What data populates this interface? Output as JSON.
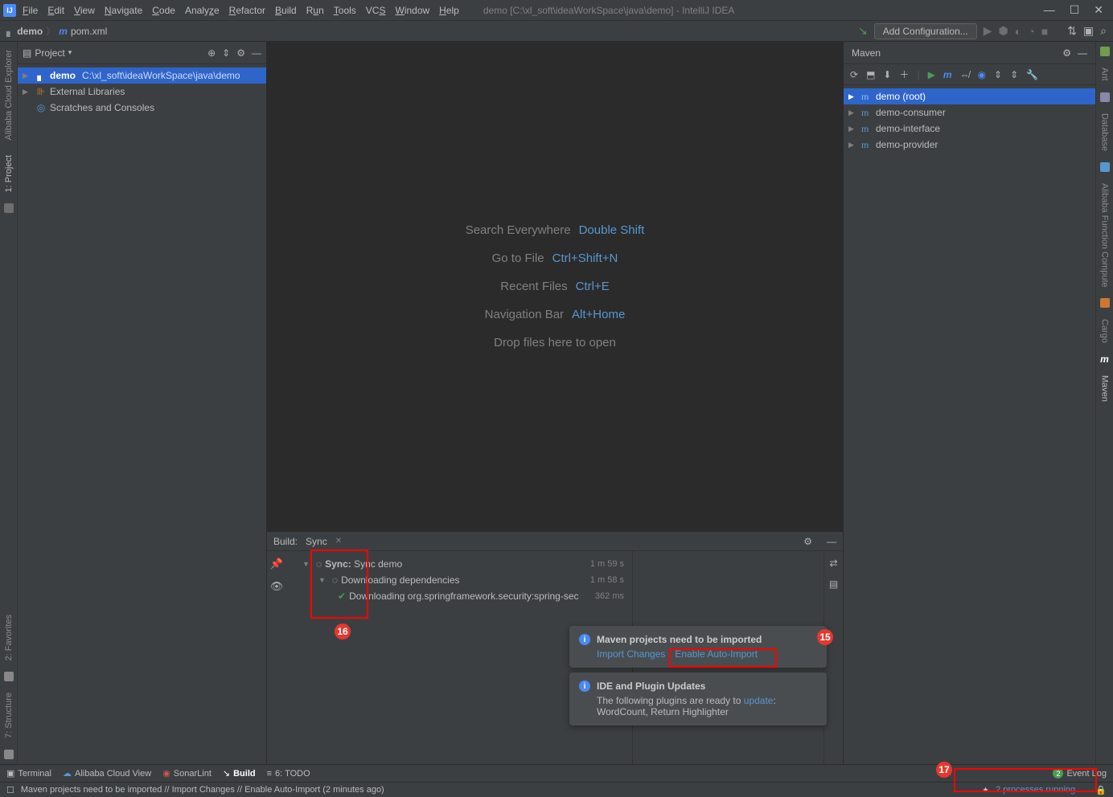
{
  "titlebar": {
    "menus": [
      "File",
      "Edit",
      "View",
      "Navigate",
      "Code",
      "Analyze",
      "Refactor",
      "Build",
      "Run",
      "Tools",
      "VCS",
      "Window",
      "Help"
    ],
    "title": "demo [C:\\xl_soft\\ideaWorkSpace\\java\\demo] - IntelliJ IDEA"
  },
  "breadcrumb": {
    "project": "demo",
    "file": "pom.xml"
  },
  "toolbar": {
    "config_label": "Add Configuration..."
  },
  "project": {
    "panel_title": "Project",
    "root_name": "demo",
    "root_path": "C:\\xl_soft\\ideaWorkSpace\\java\\demo",
    "ext_libs": "External Libraries",
    "scratches": "Scratches and Consoles"
  },
  "welcome": {
    "rows": [
      {
        "label": "Search Everywhere",
        "key": "Double Shift"
      },
      {
        "label": "Go to File",
        "key": "Ctrl+Shift+N"
      },
      {
        "label": "Recent Files",
        "key": "Ctrl+E"
      },
      {
        "label": "Navigation Bar",
        "key": "Alt+Home"
      },
      {
        "label": "Drop files here to open",
        "key": ""
      }
    ]
  },
  "build": {
    "title": "Build:",
    "tab": "Sync",
    "r1_label": "Sync:",
    "r1_val": "Sync demo",
    "r1_time": "1 m 59 s",
    "r2_val": "Downloading dependencies",
    "r2_time": "1 m 58 s",
    "r3_val": "Downloading org.springframework.security:spring-sec",
    "r3_time": "362 ms"
  },
  "maven": {
    "title": "Maven",
    "items": [
      "demo (root)",
      "demo-consumer",
      "demo-interface",
      "demo-provider"
    ]
  },
  "notif1": {
    "title": "Maven projects need to be imported",
    "link1": "Import Changes",
    "link2": "Enable Auto-Import"
  },
  "notif2": {
    "title": "IDE and Plugin Updates",
    "body1": "The following plugins are ready to ",
    "link": "update",
    "body2": ": WordCount, Return Highlighter"
  },
  "left_gutter": {
    "cloud": "Alibaba Cloud Explorer",
    "project": "1: Project",
    "fav": "2: Favorites",
    "struct": "7: Structure"
  },
  "right_gutter": {
    "ant": "Ant",
    "db": "Database",
    "func": "Alibaba Function Compute",
    "cargo": "Cargo",
    "maven": "Maven"
  },
  "bottombar": {
    "terminal": "Terminal",
    "cloud": "Alibaba Cloud View",
    "sonar": "SonarLint",
    "build": "Build",
    "todo": "6: TODO",
    "eventlog": "Event Log",
    "eventcount": "2"
  },
  "statusbar": {
    "msg": "Maven projects need to be imported // Import Changes // Enable Auto-Import (2 minutes ago)",
    "proc": "2 processes running..."
  },
  "labels": {
    "l15": "15",
    "l16": "16",
    "l17": "17"
  }
}
